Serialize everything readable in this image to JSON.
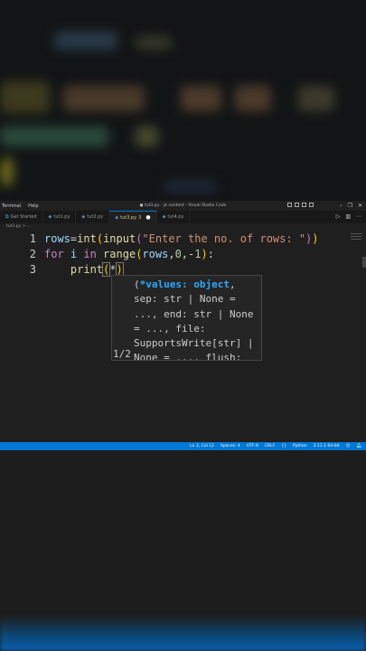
{
  "menu": {
    "terminal": "Terminal",
    "help": "Help"
  },
  "window_title": "● tut3.py - yt content - Visual Studio Code",
  "tabs": [
    {
      "label": "Get Started",
      "icon": "vscode-icon"
    },
    {
      "label": "tut1.py",
      "icon": "python-icon"
    },
    {
      "label": "tut2.py",
      "icon": "python-icon"
    },
    {
      "label": "tut3.py",
      "badge": "3",
      "icon": "python-icon",
      "active": true
    },
    {
      "label": "tut4.py",
      "icon": "python-icon"
    }
  ],
  "breadcrumb": "tut3.py > ...",
  "editor": {
    "lines": [
      {
        "number": "1"
      },
      {
        "number": "2"
      },
      {
        "number": "3"
      }
    ],
    "code": {
      "l1_var": "rows",
      "l1_eq": "=",
      "l1_int": "int",
      "l1_p1": "(",
      "l1_input": "input",
      "l1_p2": "(",
      "l1_str": "\"Enter the no. of rows: \"",
      "l1_p3": ")",
      "l1_p4": ")",
      "l2_for": "for",
      "l2_i": " i ",
      "l2_in": "in",
      "l2_range": " range",
      "l2_p1": "(",
      "l2_rows": "rows",
      "l2_c1": ",",
      "l2_n0": "0",
      "l2_c2": ",-",
      "l2_n1": "1",
      "l2_p2": ")",
      "l2_colon": ":",
      "l3_indent": "    ",
      "l3_print": "print",
      "l3_p1": "(",
      "l3_star": "*",
      "l3_p2": ")"
    }
  },
  "signature_help": {
    "active_param": "*values: object",
    "line1_open": "(",
    "line1_end": ",",
    "line2": "sep: str | None =",
    "line3": "..., end: str | None",
    "line4": "= ..., file:",
    "line5": "SupportsWrite[str] |",
    "line6": "None = ..., flush:",
    "counter": "1/2"
  },
  "status_bar": {
    "position": "Ln 3, Col 12",
    "spaces": "Spaces: 4",
    "encoding": "UTF-8",
    "eol": "CRLF",
    "language": "Python",
    "interpreter": "3.11.1 64-bit"
  },
  "colors": {
    "accent": "#0078d4",
    "keyword": "#c586c0",
    "function": "#dcdcaa",
    "string": "#ce9178",
    "number": "#b5cea8"
  }
}
